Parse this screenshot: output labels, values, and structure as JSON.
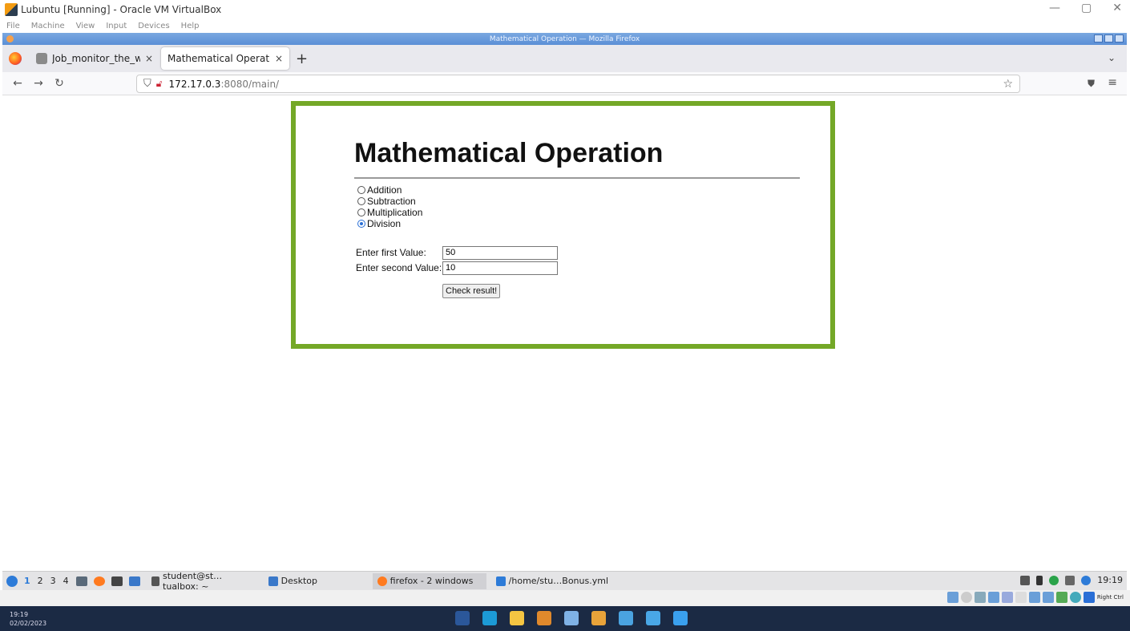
{
  "vbox": {
    "title": "Lubuntu [Running] - Oracle VM VirtualBox",
    "menu": [
      "File",
      "Machine",
      "View",
      "Input",
      "Devices",
      "Help"
    ],
    "controls": [
      "—",
      "▢",
      "✕"
    ]
  },
  "firefox": {
    "window_title": "Mathematical Operation — Mozilla Firefox",
    "tabs": [
      {
        "label": "Job_monitor_the_website",
        "active": false
      },
      {
        "label": "Mathematical Operation",
        "active": true
      }
    ],
    "url_host": "172.17.0.3",
    "url_path": ":8080/main/"
  },
  "page": {
    "title": "Mathematical Operation",
    "operations": [
      {
        "label": "Addition",
        "checked": false
      },
      {
        "label": "Subtraction",
        "checked": false
      },
      {
        "label": "Multiplication",
        "checked": false
      },
      {
        "label": "Division",
        "checked": true
      }
    ],
    "first_label": "Enter first Value:",
    "first_value": "50",
    "second_label": "Enter second Value:",
    "second_value": "10",
    "button_label": "Check result!"
  },
  "lxpanel": {
    "workspaces": [
      "1",
      "2",
      "3",
      "4"
    ],
    "tasks": [
      {
        "label": "student@st…tualbox: ~",
        "color": "#555555"
      },
      {
        "label": "Desktop",
        "color": "#3a78c9"
      },
      {
        "label": "firefox - 2 windows",
        "color": "#ff7a1f"
      },
      {
        "label": "/home/stu…Bonus.yml",
        "color": "#2d7bd8"
      }
    ],
    "clock": "19:19"
  },
  "vbox_status": {
    "host_key": "Right Ctrl"
  },
  "windows": {
    "time": "19:19",
    "date": "02/02/2023",
    "pinned": [
      {
        "name": "word-icon",
        "color": "#2b579a"
      },
      {
        "name": "edge-icon",
        "color": "#1c9ad6"
      },
      {
        "name": "file-explorer-icon",
        "color": "#f4c542"
      },
      {
        "name": "virtualbox-icon",
        "color": "#e0892c"
      },
      {
        "name": "app-icon",
        "color": "#7fb2e6"
      },
      {
        "name": "chrome-icon",
        "color": "#e8a33a"
      },
      {
        "name": "remote-desktop-icon",
        "color": "#4aa3e0"
      },
      {
        "name": "notepad-icon",
        "color": "#49a7e6"
      },
      {
        "name": "store-icon",
        "color": "#3aa0ee"
      }
    ]
  },
  "colors": {
    "frame_border": "#74a827",
    "radio_checked": "#2a6fd6"
  }
}
